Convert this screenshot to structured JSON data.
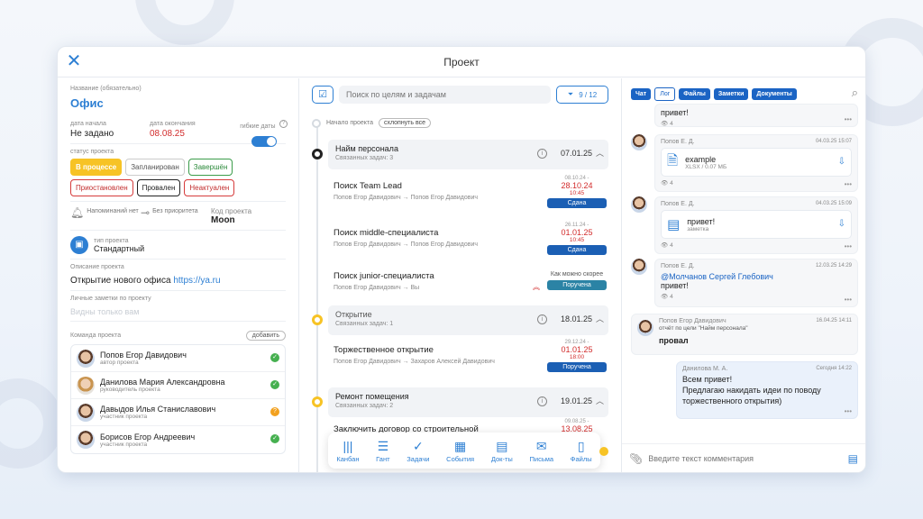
{
  "window": {
    "title": "Проект"
  },
  "left": {
    "name_label": "Название (обязательно)",
    "name_value": "Офис",
    "start_label": "дата начала",
    "start_value": "Не задано",
    "end_label": "дата окончания",
    "end_value": "08.08.25",
    "flex_label": "гибкие даты",
    "status_label": "статус проекта",
    "statuses": [
      "В процессе",
      "Запланирован",
      "Завершён",
      "Приостановлен",
      "Провален",
      "Неактуален"
    ],
    "reminder": "Напоминаний нет",
    "priority": "Без приоритета",
    "code_label": "Код проекта",
    "code_value": "Moon",
    "type_label": "тип проекта",
    "type_value": "Стандартный",
    "desc_label": "Описание проекта",
    "desc_text": "Открытие нового офиса",
    "desc_link": "https://ya.ru",
    "notes_label": "Личные заметки по проекту",
    "notes_placeholder": "Видны только вам",
    "team_label": "Команда проекта",
    "add_label": "добавить",
    "team": [
      {
        "name": "Попов Егор Давидович",
        "role": "автор проекта",
        "status": "ok"
      },
      {
        "name": "Данилова Мария Александровна",
        "role": "руководитель проекта",
        "status": "ok"
      },
      {
        "name": "Давыдов Илья Станиславович",
        "role": "участник проекта",
        "status": "pending"
      },
      {
        "name": "Борисов Егор Андреевич",
        "role": "участник проекта",
        "status": "ok"
      }
    ]
  },
  "mid": {
    "search_placeholder": "Поиск по целям и задачам",
    "filter_count": "9 / 12",
    "start_text": "Начало проекта",
    "collapse_label": "схлопнуть все",
    "goals": [
      {
        "name": "Найм персонала",
        "sub": "Связанных задач: 3",
        "date": "07.01.25"
      },
      {
        "name": "Открытие",
        "sub": "Связанных задач: 1",
        "date": "18.01.25"
      },
      {
        "name": "Ремонт помещения",
        "sub": "Связанных задач: 2",
        "date": "19.01.25"
      }
    ],
    "tasks": [
      {
        "name": "Поиск Team Lead",
        "who": "Попов Егор Давидович → Попов Егор Давидович",
        "small": "08.10.24 -",
        "due": "28.10.24",
        "time": "10:45",
        "badge": "Сдана"
      },
      {
        "name": "Поиск middle-специалиста",
        "who": "Попов Егор Давидович → Попов Егор Давидович",
        "small": "26.11.24 -",
        "due": "01.01.25",
        "time": "10:45",
        "badge": "Сдана"
      },
      {
        "name": "Поиск junior-специалиста",
        "who": "Попов Егор Давидович → Вы",
        "soon": "Как можно скорее",
        "badge": "Поручена"
      },
      {
        "name": "Торжественное открытие",
        "who": "Попов Егор Давидович → Захаров Алексей Давидович",
        "small": "29.12.24 -",
        "due": "01.01.25",
        "time": "18:00",
        "badge": "Поручена"
      },
      {
        "name": "Заключить договор со строительной",
        "small": "09.08.25 -",
        "due": "13.08.25"
      }
    ],
    "nav": [
      "Канбан",
      "Гант",
      "Задачи",
      "События",
      "Док-ты",
      "Письма",
      "Файлы"
    ]
  },
  "right": {
    "tabs": [
      "Чат",
      "Лог",
      "Файлы",
      "Заметки",
      "Документы"
    ],
    "msg0_text": "привет!",
    "msg0_views": "4",
    "msgs": [
      {
        "who": "Попов Е. Д.",
        "when": "04.03.25 15:07",
        "file": "example",
        "meta": "XLSX / 0.07 МБ",
        "views": "4"
      },
      {
        "who": "Попов Е. Д.",
        "when": "04.03.25 15:09",
        "file": "привет!",
        "meta": "заметка",
        "views": "4"
      },
      {
        "who": "Попов Е. Д.",
        "when": "12.03.25 14:29",
        "mention": "@Молчанов Сергей Глебович",
        "text": "привет!",
        "views": "4"
      },
      {
        "who": "Попов Егор Давидович",
        "when": "16.04.25 14:11",
        "sub": "отчёт по цели \"Найм персонала\"",
        "text": "провал"
      },
      {
        "who": "Данилова М. А.",
        "when": "Сегодня 14:22",
        "text": "Всем привет!\nПредлагаю накидать идеи по поводу торжественного открытия)"
      }
    ],
    "comment_placeholder": "Введите текст комментария"
  }
}
